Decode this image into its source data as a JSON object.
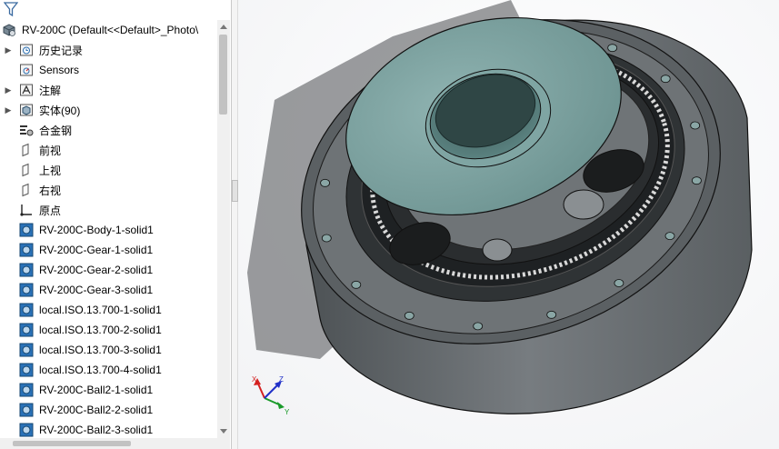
{
  "tree": {
    "root_label": "RV-200C  (Default<<Default>_Photo\\",
    "items": [
      {
        "label": "历史记录",
        "icon": "history-folder-icon",
        "expandable": true
      },
      {
        "label": "Sensors",
        "icon": "sensors-icon",
        "expandable": false
      },
      {
        "label": "注解",
        "icon": "annotations-icon",
        "expandable": true
      },
      {
        "label": "实体(90)",
        "icon": "solid-bodies-folder-icon",
        "expandable": true
      },
      {
        "label": "合金钢",
        "icon": "material-icon",
        "expandable": false
      },
      {
        "label": "前视",
        "icon": "plane-icon",
        "expandable": false
      },
      {
        "label": "上视",
        "icon": "plane-icon",
        "expandable": false
      },
      {
        "label": "右视",
        "icon": "plane-icon",
        "expandable": false
      },
      {
        "label": "原点",
        "icon": "origin-icon",
        "expandable": false
      },
      {
        "label": "RV-200C-Body-1-solid1",
        "icon": "solid-body-icon",
        "expandable": false
      },
      {
        "label": "RV-200C-Gear-1-solid1",
        "icon": "solid-body-icon",
        "expandable": false
      },
      {
        "label": "RV-200C-Gear-2-solid1",
        "icon": "solid-body-icon",
        "expandable": false
      },
      {
        "label": "RV-200C-Gear-3-solid1",
        "icon": "solid-body-icon",
        "expandable": false
      },
      {
        "label": "local.ISO.13.700-1-solid1",
        "icon": "solid-body-icon",
        "expandable": false
      },
      {
        "label": "local.ISO.13.700-2-solid1",
        "icon": "solid-body-icon",
        "expandable": false
      },
      {
        "label": "local.ISO.13.700-3-solid1",
        "icon": "solid-body-icon",
        "expandable": false
      },
      {
        "label": "local.ISO.13.700-4-solid1",
        "icon": "solid-body-icon",
        "expandable": false
      },
      {
        "label": "RV-200C-Ball2-1-solid1",
        "icon": "solid-body-icon",
        "expandable": false
      },
      {
        "label": "RV-200C-Ball2-2-solid1",
        "icon": "solid-body-icon",
        "expandable": false
      },
      {
        "label": "RV-200C-Ball2-3-solid1",
        "icon": "solid-body-icon",
        "expandable": false
      }
    ]
  },
  "triad": {
    "x_label": "X",
    "y_label": "Y",
    "z_label": "Z"
  },
  "colors": {
    "body_gray": "#6b7073",
    "flange_dark": "#3a3f42",
    "cover_teal": "#7a9e9c",
    "accent_blue": "#2c7fc0"
  }
}
